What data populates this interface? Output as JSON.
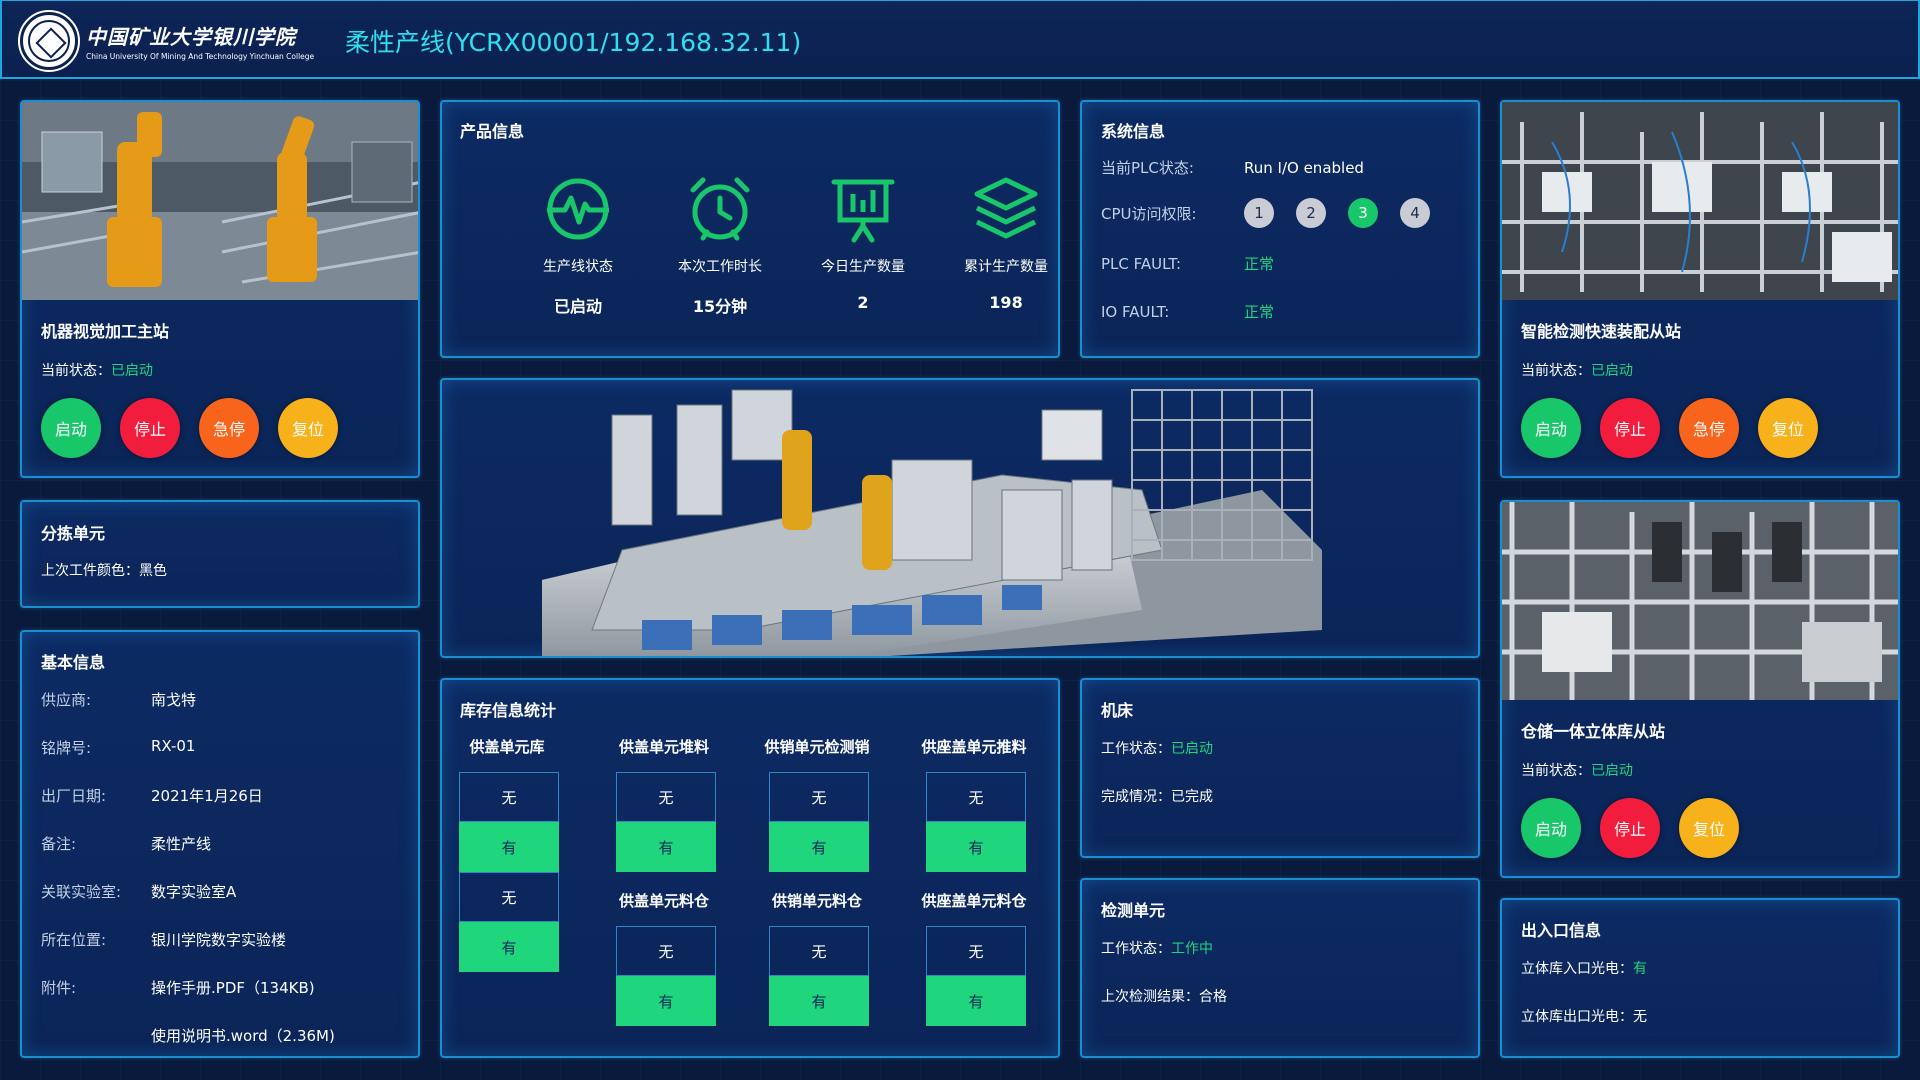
{
  "header": {
    "logo_cn": "中国矿业大学银川学院",
    "logo_en": "China University Of Mining And Technology Yinchuan College",
    "title": "柔性产线(YCRX00001/192.168.32.11)"
  },
  "station_main": {
    "name": "机器视觉加工主站",
    "status_label": "当前状态：",
    "status_value": "已启动",
    "buttons": [
      "启动",
      "停止",
      "急停",
      "复位"
    ]
  },
  "sorting_unit": {
    "title": "分拣单元",
    "label": "上次工件颜色：",
    "value": "黑色"
  },
  "basic_info": {
    "title": "基本信息",
    "rows": [
      {
        "k": "供应商:",
        "v": "南戈特"
      },
      {
        "k": "铭牌号:",
        "v": "RX-01"
      },
      {
        "k": "出厂日期:",
        "v": "2021年1月26日"
      },
      {
        "k": "备注:",
        "v": "柔性产线"
      },
      {
        "k": "关联实验室:",
        "v": "数字实验室A"
      },
      {
        "k": "所在位置:",
        "v": "银川学院数字实验楼"
      },
      {
        "k": "附件:",
        "v": "操作手册.PDF（134KB)"
      },
      {
        "k": "",
        "v": "使用说明书.word（2.36M)"
      }
    ]
  },
  "product_info": {
    "title": "产品信息",
    "kpis": [
      {
        "icon": "pulse-icon",
        "label": "生产线状态",
        "value": "已启动"
      },
      {
        "icon": "alarm-clock-icon",
        "label": "本次工作时长",
        "value": "15分钟"
      },
      {
        "icon": "presentation-board-icon",
        "label": "今日生产数量",
        "value": "2"
      },
      {
        "icon": "layers-icon",
        "label": "累计生产数量",
        "value": "198"
      }
    ]
  },
  "system_info": {
    "title": "系统信息",
    "plc_label": "当前PLC状态:",
    "plc_value": "Run I/O enabled",
    "cpu_label": "CPU访问权限:",
    "cpu_levels": [
      "1",
      "2",
      "3",
      "4"
    ],
    "cpu_active": "3",
    "plc_fault_label": "PLC FAULT:",
    "plc_fault_value": "正常",
    "io_fault_label": "IO FAULT:",
    "io_fault_value": "正常"
  },
  "inventory": {
    "title": "库存信息统计",
    "headers": [
      "供盖单元库",
      "供盖单元堆料",
      "供销单元检测销",
      "供座盖单元推料",
      "供盖单元料仓",
      "供销单元料仓",
      "供座盖单元料仓"
    ],
    "no": "无",
    "yes": "有"
  },
  "machine_tool": {
    "title": "机床",
    "status_label": "工作状态：",
    "status_value": "已启动",
    "done_label": "完成情况：",
    "done_value": "已完成"
  },
  "inspection_unit": {
    "title": "检测单元",
    "status_label": "工作状态：",
    "status_value": "工作中",
    "result_label": "上次检测结果：",
    "result_value": "合格"
  },
  "station_assembly": {
    "name": "智能检测快速装配从站",
    "status_label": "当前状态：",
    "status_value": "已启动",
    "buttons": [
      "启动",
      "停止",
      "急停",
      "复位"
    ]
  },
  "station_warehouse": {
    "name": "仓储一体立体库从站",
    "status_label": "当前状态：",
    "status_value": "已启动",
    "buttons": [
      "启动",
      "停止",
      "复位"
    ]
  },
  "io_info": {
    "title": "出入口信息",
    "in_label": "立体库入口光电：",
    "in_value": "有",
    "out_label": "立体库出口光电：",
    "out_value": "无"
  },
  "colors": {
    "accent": "#2de0f0",
    "border": "#1a8ed0",
    "ok": "#1fd67d",
    "start": "#19c76b",
    "stop": "#f21d3c",
    "estop": "#f8641b",
    "reset": "#f7b11a"
  }
}
